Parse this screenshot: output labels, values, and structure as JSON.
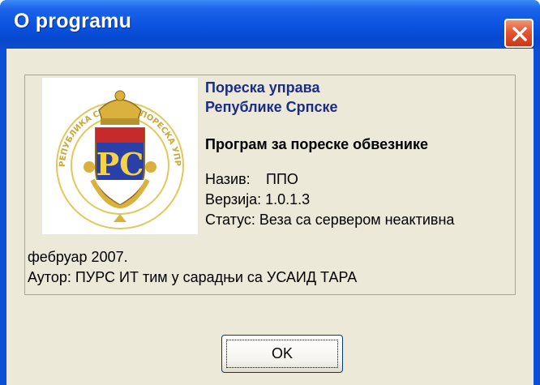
{
  "window": {
    "title": "O programu",
    "close_icon": "close-icon"
  },
  "logo": {
    "seal_text": "РЕПУБЛИКА СРПСКА · ПОРЕСКА УПРАВА",
    "monogram": "PC",
    "colors": [
      "#c62a2a",
      "#2a3fa8",
      "#f2d34a"
    ]
  },
  "info": {
    "org_line1": "Пореска управа",
    "org_line2": "Републике Српске",
    "program_title": "Програм за пореске обвезнике",
    "name_label": "Назив:",
    "name_value": "ППО",
    "version_line": "Верзија: 1.0.1.3",
    "status_line": "Статус: Веза са сервером неактивна",
    "date_line": "фебруар 2007.",
    "author_line": "Аутор: ПУРС ИТ тим у сарадњи са УСАИД ТАРА"
  },
  "buttons": {
    "ok_label": "OK"
  }
}
